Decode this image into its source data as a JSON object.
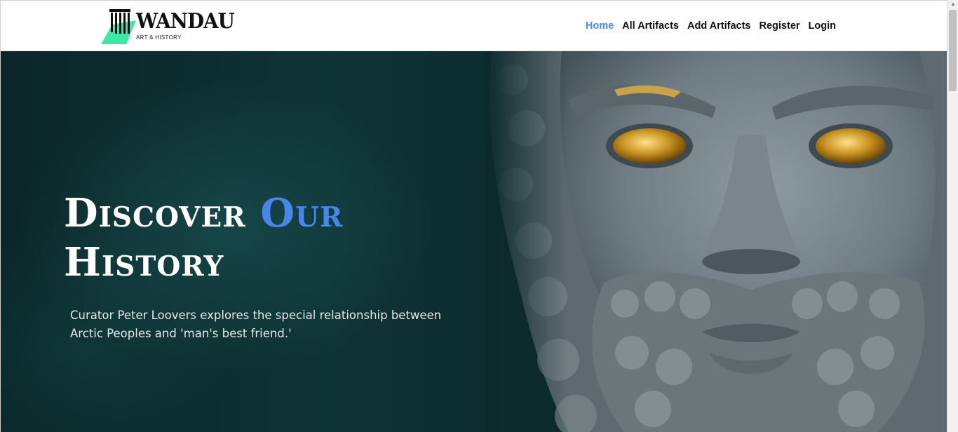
{
  "brand": {
    "name": "WANDAU",
    "tagline": "ART & HISTORY"
  },
  "nav": {
    "items": [
      {
        "label": "Home",
        "active": true
      },
      {
        "label": "All Artifacts",
        "active": false
      },
      {
        "label": "Add Artifacts",
        "active": false
      },
      {
        "label": "Register",
        "active": false
      },
      {
        "label": "Login",
        "active": false
      }
    ]
  },
  "hero": {
    "title_part1": "Discover",
    "title_accent": "Our",
    "title_part2": "History",
    "description": "Curator Peter Loovers explores the special relationship between Arctic Peoples and 'man's best friend.'"
  },
  "colors": {
    "accent": "#4a86e8",
    "hero_background": "#0e3335",
    "logo_green": "#3ee6a8"
  }
}
